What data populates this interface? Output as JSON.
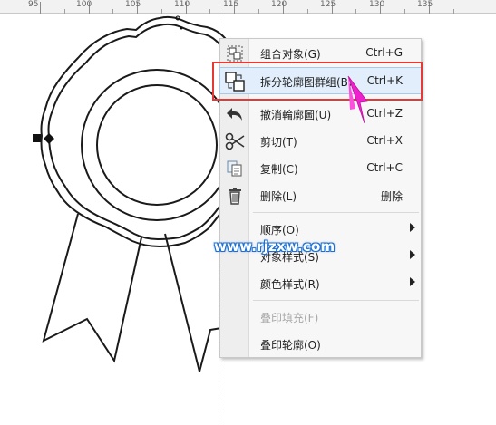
{
  "ruler": {
    "labels": [
      "95",
      "100",
      "105",
      "110",
      "115",
      "120",
      "125",
      "130",
      "135"
    ]
  },
  "watermark": "www.rjzxw.com",
  "colors": {
    "highlight_box": "#e53935",
    "arrow": "#ee22cc",
    "menu_hover": "#e2eefb",
    "watermark_outline": "#1e6fd0"
  },
  "context_menu": {
    "items": [
      {
        "label": "组合对象(G)",
        "shortcut": "Ctrl+G",
        "icon": "group-icon"
      },
      {
        "label": "拆分轮廓图群组(B)",
        "shortcut": "Ctrl+K",
        "icon": "break-apart-icon"
      },
      {
        "label": "撤消輪廓圖(U)",
        "shortcut": "Ctrl+Z",
        "icon": "undo-icon"
      },
      {
        "label": "剪切(T)",
        "shortcut": "Ctrl+X",
        "icon": "scissors-icon"
      },
      {
        "label": "复制(C)",
        "shortcut": "Ctrl+C",
        "icon": "copy-icon"
      },
      {
        "label": "删除(L)",
        "shortcut": "删除",
        "icon": "trash-icon"
      },
      {
        "label": "顺序(O)",
        "shortcut": "",
        "icon": ""
      },
      {
        "label": "对象样式(S)",
        "shortcut": "",
        "icon": ""
      },
      {
        "label": "颜色样式(R)",
        "shortcut": "",
        "icon": ""
      },
      {
        "label": "叠印填充(F)",
        "shortcut": "",
        "icon": ""
      },
      {
        "label": "叠印轮廓(O)",
        "shortcut": "",
        "icon": ""
      }
    ]
  }
}
